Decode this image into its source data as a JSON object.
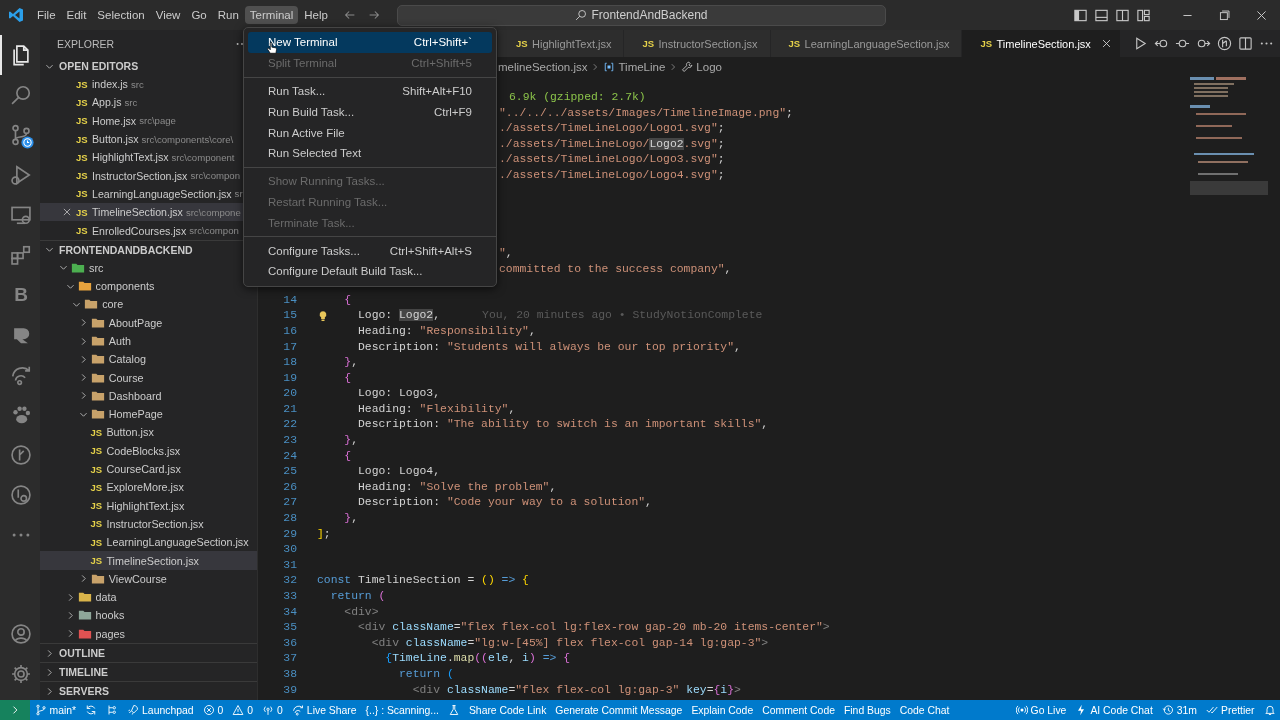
{
  "title_bar": {
    "menus": [
      {
        "label": "File",
        "selected": false
      },
      {
        "label": "Edit",
        "selected": false
      },
      {
        "label": "Selection",
        "selected": false
      },
      {
        "label": "View",
        "selected": false
      },
      {
        "label": "Go",
        "selected": false
      },
      {
        "label": "Run",
        "selected": false
      },
      {
        "label": "Terminal",
        "selected": true
      },
      {
        "label": "Help",
        "selected": false
      }
    ],
    "search": "FrontendAndBackend"
  },
  "activity_bar": [
    {
      "kind": "files",
      "selected": true
    },
    {
      "kind": "search",
      "selected": false
    },
    {
      "kind": "source-control",
      "selected": false,
      "badge": true
    },
    {
      "kind": "run-debug",
      "selected": false
    },
    {
      "kind": "remote",
      "selected": false
    },
    {
      "kind": "extensions",
      "selected": false
    },
    {
      "kind": "letter",
      "glyph": "B",
      "selected": false
    },
    {
      "kind": "round-logo",
      "selected": false
    },
    {
      "kind": "liveshare",
      "selected": false
    },
    {
      "kind": "paw",
      "selected": false
    },
    {
      "kind": "circle-branch",
      "selected": false
    },
    {
      "kind": "circle-gear",
      "selected": false
    },
    {
      "kind": "more",
      "selected": false
    }
  ],
  "activity_bottom": [
    {
      "kind": "account"
    },
    {
      "kind": "gear"
    }
  ],
  "explorer": {
    "title": "EXPLORER",
    "open_editors": {
      "title": "OPEN EDITORS",
      "expanded": true,
      "items": [
        {
          "icon_text": "JS",
          "name": "index.js",
          "path": "src",
          "selected": false
        },
        {
          "icon_text": "JS",
          "name": "App.js",
          "path": "src",
          "selected": false
        },
        {
          "icon_text": "JS",
          "name": "Home.jsx",
          "path": "src\\page",
          "selected": false
        },
        {
          "icon_text": "JS",
          "name": "Button.jsx",
          "path": "src\\components\\core\\",
          "selected": false
        },
        {
          "icon_text": "JS",
          "name": "HighlightText.jsx",
          "path": "src\\component",
          "selected": false
        },
        {
          "icon_text": "JS",
          "name": "InstructorSection.jsx",
          "path": "src\\compon",
          "selected": false
        },
        {
          "icon_text": "JS",
          "name": "LearningLanguageSection.jsx",
          "path": "sr",
          "selected": false
        },
        {
          "icon_text": "JS",
          "name": "TimelineSection.jsx",
          "path": "src\\compone",
          "selected": true
        },
        {
          "icon_text": "JS",
          "name": "EnrolledCourses.jsx",
          "path": "src\\compon",
          "selected": false
        }
      ]
    },
    "project": {
      "title": "FRONTENDANDBACKEND",
      "expanded": true,
      "tree": [
        {
          "kind": "folder",
          "name": "src",
          "color": "#4caf50",
          "expanded": true,
          "children": [
            {
              "kind": "folder",
              "name": "components",
              "color": "#e8a33d",
              "expanded": true,
              "children": [
                {
                  "kind": "folder",
                  "name": "core",
                  "color": "#c8a26a",
                  "expanded": true,
                  "children": [
                    {
                      "kind": "folder",
                      "name": "AboutPage",
                      "color": "#c8a26a",
                      "expanded": false
                    },
                    {
                      "kind": "folder",
                      "name": "Auth",
                      "color": "#c8a26a",
                      "expanded": false
                    },
                    {
                      "kind": "folder",
                      "name": "Catalog",
                      "color": "#c8a26a",
                      "expanded": false
                    },
                    {
                      "kind": "folder",
                      "name": "Course",
                      "color": "#c8a26a",
                      "expanded": false
                    },
                    {
                      "kind": "folder",
                      "name": "Dashboard",
                      "color": "#c8a26a",
                      "expanded": false
                    },
                    {
                      "kind": "folder",
                      "name": "HomePage",
                      "color": "#c8a26a",
                      "expanded": true,
                      "children": [
                        {
                          "kind": "file",
                          "icon_text": "JS",
                          "name": "Button.jsx",
                          "selected": false
                        },
                        {
                          "kind": "file",
                          "icon_text": "JS",
                          "name": "CodeBlocks.jsx",
                          "selected": false
                        },
                        {
                          "kind": "file",
                          "icon_text": "JS",
                          "name": "CourseCard.jsx",
                          "selected": false
                        },
                        {
                          "kind": "file",
                          "icon_text": "JS",
                          "name": "ExploreMore.jsx",
                          "selected": false
                        },
                        {
                          "kind": "file",
                          "icon_text": "JS",
                          "name": "HighlightText.jsx",
                          "selected": false
                        },
                        {
                          "kind": "file",
                          "icon_text": "JS",
                          "name": "InstructorSection.jsx",
                          "selected": false
                        },
                        {
                          "kind": "file",
                          "icon_text": "JS",
                          "name": "LearningLanguageSection.jsx",
                          "selected": false
                        },
                        {
                          "kind": "file",
                          "icon_text": "JS",
                          "name": "TimelineSection.jsx",
                          "selected": true
                        }
                      ]
                    },
                    {
                      "kind": "folder",
                      "name": "ViewCourse",
                      "color": "#c8a26a",
                      "expanded": false
                    }
                  ]
                }
              ]
            },
            {
              "kind": "folder",
              "name": "data",
              "color": "#d9b44a",
              "expanded": false
            },
            {
              "kind": "folder",
              "name": "hooks",
              "color": "#8fa79a",
              "expanded": false
            },
            {
              "kind": "folder",
              "name": "pages",
              "color": "#e05252",
              "expanded": false
            }
          ]
        }
      ]
    },
    "sections": [
      {
        "title": "OUTLINE",
        "expanded": false
      },
      {
        "title": "TIMELINE",
        "expanded": false
      },
      {
        "title": "SERVERS",
        "expanded": false
      }
    ]
  },
  "tabs": [
    {
      "icon_text": "JS",
      "name": "HighlightText.jsx",
      "selected": false
    },
    {
      "icon_text": "JS",
      "name": "InstructorSection.jsx",
      "selected": false
    },
    {
      "icon_text": "JS",
      "name": "LearningLanguageSection.jsx",
      "selected": false
    },
    {
      "icon_text": "JS",
      "name": "TimelineSection.jsx",
      "selected": true
    }
  ],
  "editor_actions": [
    {
      "kind": "run"
    },
    {
      "kind": "back"
    },
    {
      "kind": "dot"
    },
    {
      "kind": "forward"
    },
    {
      "kind": "git"
    },
    {
      "kind": "split"
    },
    {
      "kind": "more"
    }
  ],
  "breadcrumb": [
    {
      "kind": "file",
      "label": "melineSection.jsx"
    },
    {
      "kind": "symbol",
      "label": "TimeLine"
    },
    {
      "kind": "property",
      "label": "Logo"
    }
  ],
  "editor": {
    "covered_top": [
      {
        "tokens": [
          {
            "hint": "6.9k (gzipped: 2.7k)"
          }
        ]
      },
      {
        "tokens": [
          {
            "str": "\"../../../assets/Images/TimelineImage.png\""
          },
          {
            "p": ";"
          }
        ]
      },
      {
        "tokens": [
          {
            "str": "./assets/TimeLineLogo/Logo1.svg\""
          },
          {
            "p": ";"
          }
        ]
      },
      {
        "tokens": [
          {
            "str": "./assets/TimeLineLogo/"
          },
          {
            "match": "Logo2"
          },
          {
            "str": ".svg\""
          },
          {
            "p": ";"
          }
        ]
      },
      {
        "tokens": [
          {
            "str": "./assets/TimeLineLogo/Logo3.svg\""
          },
          {
            "p": ";"
          }
        ]
      },
      {
        "tokens": [
          {
            "str": "./assets/TimeLineLogo/Logo4.svg\""
          },
          {
            "p": ";"
          }
        ]
      }
    ],
    "covered_mid": [
      {
        "tokens": [
          {
            "str": "\""
          },
          {
            "p": ","
          }
        ]
      },
      {
        "tokens": [
          {
            "str": "committed to the success company\""
          },
          {
            "p": ","
          }
        ]
      }
    ],
    "lines": [
      {
        "number": "14",
        "tokens": [
          {
            "brace": "    {"
          }
        ]
      },
      {
        "number": "15",
        "lightbulb": true,
        "blame": "You, 20 minutes ago • StudyNotionComplete",
        "tokens": [
          {
            "p": "      Logo: "
          },
          {
            "match": "Logo2"
          },
          {
            "p": ","
          }
        ]
      },
      {
        "number": "16",
        "tokens": [
          {
            "p": "      Heading: "
          },
          {
            "str": "\"Responsibility\""
          },
          {
            "p": ","
          }
        ]
      },
      {
        "number": "17",
        "tokens": [
          {
            "p": "      Description: "
          },
          {
            "str": "\"Students will always be our top priority\""
          },
          {
            "p": ","
          }
        ]
      },
      {
        "number": "18",
        "tokens": [
          {
            "brace": "    }"
          },
          {
            "p": ","
          }
        ]
      },
      {
        "number": "19",
        "tokens": [
          {
            "brace": "    {"
          }
        ]
      },
      {
        "number": "20",
        "tokens": [
          {
            "p": "      Logo: Logo3,"
          }
        ]
      },
      {
        "number": "21",
        "tokens": [
          {
            "p": "      Heading: "
          },
          {
            "str": "\"Flexibility\""
          },
          {
            "p": ","
          }
        ]
      },
      {
        "number": "22",
        "tokens": [
          {
            "p": "      Description: "
          },
          {
            "str": "\"The ability to switch is an important skills\""
          },
          {
            "p": ","
          }
        ]
      },
      {
        "number": "23",
        "tokens": [
          {
            "brace": "    }"
          },
          {
            "p": ","
          }
        ]
      },
      {
        "number": "24",
        "tokens": [
          {
            "brace": "    {"
          }
        ]
      },
      {
        "number": "25",
        "tokens": [
          {
            "p": "      Logo: Logo4,"
          }
        ]
      },
      {
        "number": "26",
        "tokens": [
          {
            "p": "      Heading: "
          },
          {
            "str": "\"Solve the problem\""
          },
          {
            "p": ","
          }
        ]
      },
      {
        "number": "27",
        "tokens": [
          {
            "p": "      Description: "
          },
          {
            "str": "\"Code your way to a solution\""
          },
          {
            "p": ","
          }
        ]
      },
      {
        "number": "28",
        "tokens": [
          {
            "brace": "    }"
          },
          {
            "p": ","
          }
        ]
      },
      {
        "number": "29",
        "tokens": [
          {
            "brace2": "]"
          },
          {
            "p": ";"
          }
        ]
      },
      {
        "number": "30"
      },
      {
        "number": "31"
      },
      {
        "number": "32",
        "tokens": [
          {
            "kw": "const"
          },
          {
            "p": " TimelineSection = "
          },
          {
            "brace2": "()"
          },
          {
            "kw": " => "
          },
          {
            "brace2": "{"
          }
        ]
      },
      {
        "number": "33",
        "tokens": [
          {
            "kw": "  return"
          },
          {
            "brace": " ("
          }
        ]
      },
      {
        "number": "34",
        "tokens": [
          {
            "tag": "    <div>"
          }
        ]
      },
      {
        "number": "35",
        "tokens": [
          {
            "tag": "      <div"
          },
          {
            "attr": " className"
          },
          {
            "p": "="
          },
          {
            "str": "\"flex flex-col lg:flex-row gap-20 mb-20 items-center\""
          },
          {
            "tag": ">"
          }
        ]
      },
      {
        "number": "36",
        "tokens": [
          {
            "tag": "        <div"
          },
          {
            "attr": " className"
          },
          {
            "p": "="
          },
          {
            "str": "\"lg:w-[45%] flex flex-col gap-14 lg:gap-3\""
          },
          {
            "tag": ">"
          }
        ]
      },
      {
        "number": "37",
        "tokens": [
          {
            "brace3": "          {"
          },
          {
            "var": "TimeLine"
          },
          {
            "p": "."
          },
          {
            "fn": "map"
          },
          {
            "brace": "(("
          },
          {
            "var": "ele"
          },
          {
            "p": ", "
          },
          {
            "var": "i"
          },
          {
            "brace": ")"
          },
          {
            "kw": " => "
          },
          {
            "brace": "{"
          }
        ]
      },
      {
        "number": "38",
        "tokens": [
          {
            "kw": "            return"
          },
          {
            "brace3": " ("
          }
        ]
      },
      {
        "number": "39",
        "tokens": [
          {
            "tag": "              <div"
          },
          {
            "attr": " className"
          },
          {
            "p": "="
          },
          {
            "str": "\"flex flex-col lg:gap-3\""
          },
          {
            "attr": " key"
          },
          {
            "p": "="
          },
          {
            "brace": "{"
          },
          {
            "var": "i"
          },
          {
            "brace": "}"
          },
          {
            "tag": ">"
          }
        ]
      }
    ]
  },
  "menu": {
    "items": [
      {
        "kind": "item",
        "label": "New Terminal",
        "shortcut": "Ctrl+Shift+`",
        "selected": true,
        "disabled": false
      },
      {
        "kind": "item",
        "label": "Split Terminal",
        "shortcut": "Ctrl+Shift+5",
        "selected": false,
        "disabled": true
      },
      {
        "kind": "separator"
      },
      {
        "kind": "item",
        "label": "Run Task...",
        "shortcut": "Shift+Alt+F10",
        "selected": false,
        "disabled": false
      },
      {
        "kind": "item",
        "label": "Run Build Task...",
        "shortcut": "Ctrl+F9",
        "selected": false,
        "disabled": false
      },
      {
        "kind": "item",
        "label": "Run Active File",
        "selected": false,
        "disabled": false
      },
      {
        "kind": "item",
        "label": "Run Selected Text",
        "selected": false,
        "disabled": false
      },
      {
        "kind": "separator"
      },
      {
        "kind": "item",
        "label": "Show Running Tasks...",
        "selected": false,
        "disabled": true
      },
      {
        "kind": "item",
        "label": "Restart Running Task...",
        "selected": false,
        "disabled": true
      },
      {
        "kind": "item",
        "label": "Terminate Task...",
        "selected": false,
        "disabled": true
      },
      {
        "kind": "separator"
      },
      {
        "kind": "item",
        "label": "Configure Tasks...",
        "shortcut": "Ctrl+Shift+Alt+S",
        "selected": false,
        "disabled": false
      },
      {
        "kind": "item",
        "label": "Configure Default Build Task...",
        "selected": false,
        "disabled": false
      }
    ]
  },
  "status_bar": {
    "left": [
      {
        "kind": "remote"
      },
      {
        "kind": "branch",
        "text": "main*"
      },
      {
        "kind": "sync"
      },
      {
        "kind": "tree"
      },
      {
        "kind": "rocket",
        "text": "Launchpad"
      },
      {
        "kind": "error",
        "text": "0"
      },
      {
        "kind": "warning",
        "text": "0"
      },
      {
        "kind": "broadcast",
        "text": "0"
      },
      {
        "kind": "liveshare",
        "text": "Live Share"
      },
      {
        "kind": "plain",
        "text": "{..} : Scanning..."
      },
      {
        "kind": "flask"
      },
      {
        "kind": "plain",
        "text": "Share Code Link"
      },
      {
        "kind": "plain",
        "text": "Generate Commit Message"
      },
      {
        "kind": "plain",
        "text": "Explain Code"
      },
      {
        "kind": "plain",
        "text": "Comment Code"
      },
      {
        "kind": "plain",
        "text": "Find Bugs"
      },
      {
        "kind": "plain",
        "text": "Code Chat"
      }
    ],
    "right": [
      {
        "kind": "golive",
        "text": "Go Live"
      },
      {
        "kind": "spark",
        "text": "AI Code Chat"
      },
      {
        "kind": "history",
        "text": "31m"
      },
      {
        "kind": "checks",
        "text": "Prettier"
      },
      {
        "kind": "bell"
      }
    ]
  }
}
